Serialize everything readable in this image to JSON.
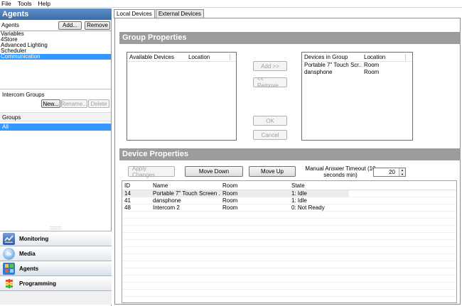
{
  "menu": [
    "File",
    "Tools",
    "Help"
  ],
  "left": {
    "header": "Agents",
    "agents_label": "Agents",
    "add_label": "Add...",
    "remove_label": "Remove",
    "agents": [
      "Variables",
      "4Store",
      "Advanced Lighting",
      "Scheduler",
      "Communication"
    ],
    "selected_agent": "Communication",
    "intercom_label": "Intercom Groups",
    "new_label": "New...",
    "rename_label": "Rename...",
    "delete_label": "Delete",
    "groups_header": "Groups",
    "groups": [
      "All"
    ],
    "splitter": "::::::::::",
    "nav": [
      {
        "label": "Monitoring",
        "icon": "monitoring-icon"
      },
      {
        "label": "Media",
        "icon": "media-icon"
      },
      {
        "label": "Agents",
        "icon": "agents-icon"
      },
      {
        "label": "Programming",
        "icon": "programming-icon"
      }
    ]
  },
  "tabs": [
    "Local Devices",
    "External Devices"
  ],
  "group_properties": {
    "title": "Group Properties",
    "available_headers": [
      "Available Devices",
      "Location"
    ],
    "group_headers": [
      "Devices in Group",
      "Location"
    ],
    "devices_in_group": [
      {
        "name": "Portable 7\" Touch Scr...",
        "location": "Room"
      },
      {
        "name": "dansphone",
        "location": "Room"
      }
    ],
    "add_label": "Add >>",
    "remove_label": "<< Remove",
    "ok_label": "OK",
    "cancel_label": "Cancel"
  },
  "device_properties": {
    "title": "Device Properties",
    "apply_label": "Apply Changes",
    "move_down_label": "Move Down",
    "move_up_label": "Move Up",
    "timeout_label": "Manual Answer Timeout (10 seconds min)",
    "timeout_value": "20",
    "columns": [
      "ID",
      "Name",
      "Room",
      "State"
    ],
    "rows": [
      {
        "id": "14",
        "name": "Portable 7\" Touch Screen ...",
        "room": "Room",
        "state": "1: Idle"
      },
      {
        "id": "41",
        "name": "dansphone",
        "room": "Room",
        "state": "1: Idle"
      },
      {
        "id": "48",
        "name": "Intercom 2",
        "room": "Room",
        "state": "0: Not Ready"
      }
    ]
  }
}
